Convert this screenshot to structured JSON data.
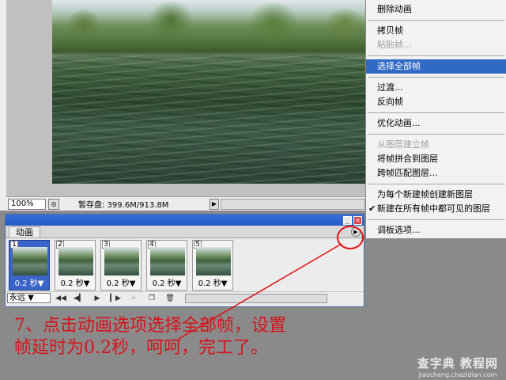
{
  "document": {
    "zoom": "100%",
    "scratch": "暂存盘: 399.6M/913.8M"
  },
  "palette": {
    "tab_label": "动画",
    "frames": [
      {
        "num": "1",
        "delay": "0.2 秒▼"
      },
      {
        "num": "2",
        "delay": "0.2 秒▼"
      },
      {
        "num": "3",
        "delay": "0.2 秒▼"
      },
      {
        "num": "4",
        "delay": "0.2 秒▼"
      },
      {
        "num": "5",
        "delay": "0.2 秒▼"
      }
    ],
    "loop": "永远"
  },
  "menu": {
    "items": [
      "删除动画",
      "拷贝帧",
      "粘贴帧...",
      "选择全部帧",
      "过渡...",
      "反向帧",
      "优化动画...",
      "从图层建立帧",
      "将帧拼合到图层",
      "跨帧匹配图层...",
      "为每个新建帧创建新图层",
      "新建在所有帧中都可见的图层",
      "调板选项..."
    ]
  },
  "annotation": {
    "line1": "7、点击动画选项选择全部帧，设置",
    "line2": "帧延时为0.2秒，呵呵，完工了。"
  },
  "watermark": {
    "main": "查字典 教程网",
    "sub": "jiaocheng.chazidian.com"
  }
}
